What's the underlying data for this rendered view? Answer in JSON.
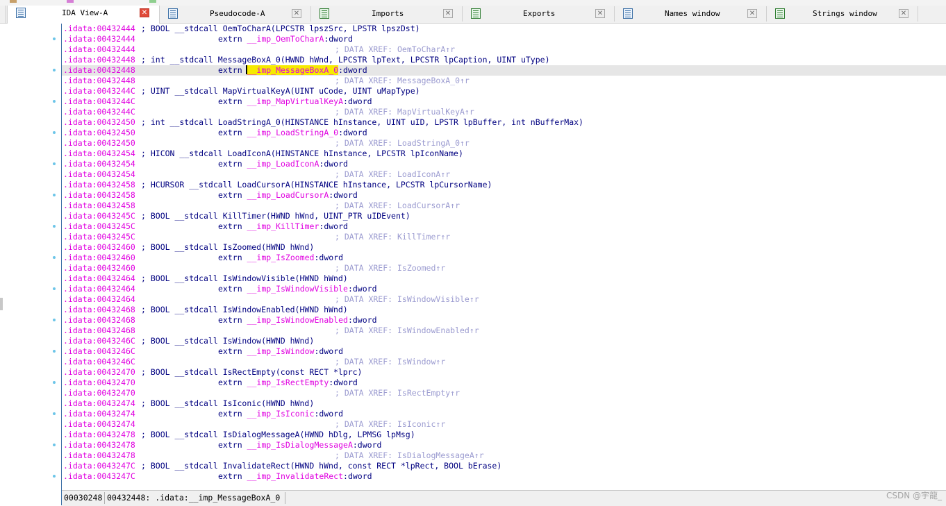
{
  "tabs": [
    {
      "label": "IDA View-A",
      "icon": "text-view-icon",
      "active": true
    },
    {
      "label": "Pseudocode-A",
      "icon": "text-view-icon",
      "active": false
    },
    {
      "label": "Imports",
      "icon": "imports-icon",
      "active": false
    },
    {
      "label": "Exports",
      "icon": "exports-icon",
      "active": false
    },
    {
      "label": "Names window",
      "icon": "names-list-icon",
      "active": false
    },
    {
      "label": "Strings window",
      "icon": "strings-icon",
      "active": false
    }
  ],
  "tab_close_glyph": "✕",
  "listing": [
    {
      "addr": ".idata:00432444",
      "text": "; BOOL __stdcall OemToCharA(LPCSTR lpszSrc, LPSTR lpszDst)",
      "kind": "comment"
    },
    {
      "addr": ".idata:00432444",
      "kw": "extrn ",
      "name": "__imp_OemToCharA",
      "tail": ":dword",
      "kind": "extrn"
    },
    {
      "addr": ".idata:00432444",
      "text": "; DATA XREF: OemToCharA↑r",
      "kind": "xref"
    },
    {
      "addr": ".idata:00432448",
      "text": "; int __stdcall MessageBoxA_0(HWND hWnd, LPCSTR lpText, LPCSTR lpCaption, UINT uType)",
      "kind": "comment"
    },
    {
      "addr": ".idata:00432448",
      "kw": "extrn ",
      "name": "__imp_MessageBoxA_0",
      "tail": ":dword",
      "kind": "extrn",
      "current": true
    },
    {
      "addr": ".idata:00432448",
      "text": "; DATA XREF: MessageBoxA_0↑r",
      "kind": "xref"
    },
    {
      "addr": ".idata:0043244C",
      "text": "; UINT __stdcall MapVirtualKeyA(UINT uCode, UINT uMapType)",
      "kind": "comment"
    },
    {
      "addr": ".idata:0043244C",
      "kw": "extrn ",
      "name": "__imp_MapVirtualKeyA",
      "tail": ":dword",
      "kind": "extrn"
    },
    {
      "addr": ".idata:0043244C",
      "text": "; DATA XREF: MapVirtualKeyA↑r",
      "kind": "xref"
    },
    {
      "addr": ".idata:00432450",
      "text": "; int __stdcall LoadStringA_0(HINSTANCE hInstance, UINT uID, LPSTR lpBuffer, int nBufferMax)",
      "kind": "comment"
    },
    {
      "addr": ".idata:00432450",
      "kw": "extrn ",
      "name": "__imp_LoadStringA_0",
      "tail": ":dword",
      "kind": "extrn"
    },
    {
      "addr": ".idata:00432450",
      "text": "; DATA XREF: LoadStringA_0↑r",
      "kind": "xref"
    },
    {
      "addr": ".idata:00432454",
      "text": "; HICON __stdcall LoadIconA(HINSTANCE hInstance, LPCSTR lpIconName)",
      "kind": "comment"
    },
    {
      "addr": ".idata:00432454",
      "kw": "extrn ",
      "name": "__imp_LoadIconA",
      "tail": ":dword",
      "kind": "extrn"
    },
    {
      "addr": ".idata:00432454",
      "text": "; DATA XREF: LoadIconA↑r",
      "kind": "xref"
    },
    {
      "addr": ".idata:00432458",
      "text": "; HCURSOR __stdcall LoadCursorA(HINSTANCE hInstance, LPCSTR lpCursorName)",
      "kind": "comment"
    },
    {
      "addr": ".idata:00432458",
      "kw": "extrn ",
      "name": "__imp_LoadCursorA",
      "tail": ":dword",
      "kind": "extrn"
    },
    {
      "addr": ".idata:00432458",
      "text": "; DATA XREF: LoadCursorA↑r",
      "kind": "xref"
    },
    {
      "addr": ".idata:0043245C",
      "text": "; BOOL __stdcall KillTimer(HWND hWnd, UINT_PTR uIDEvent)",
      "kind": "comment"
    },
    {
      "addr": ".idata:0043245C",
      "kw": "extrn ",
      "name": "__imp_KillTimer",
      "tail": ":dword",
      "kind": "extrn"
    },
    {
      "addr": ".idata:0043245C",
      "text": "; DATA XREF: KillTimer↑r",
      "kind": "xref"
    },
    {
      "addr": ".idata:00432460",
      "text": "; BOOL __stdcall IsZoomed(HWND hWnd)",
      "kind": "comment"
    },
    {
      "addr": ".idata:00432460",
      "kw": "extrn ",
      "name": "__imp_IsZoomed",
      "tail": ":dword",
      "kind": "extrn"
    },
    {
      "addr": ".idata:00432460",
      "text": "; DATA XREF: IsZoomed↑r",
      "kind": "xref"
    },
    {
      "addr": ".idata:00432464",
      "text": "; BOOL __stdcall IsWindowVisible(HWND hWnd)",
      "kind": "comment"
    },
    {
      "addr": ".idata:00432464",
      "kw": "extrn ",
      "name": "__imp_IsWindowVisible",
      "tail": ":dword",
      "kind": "extrn"
    },
    {
      "addr": ".idata:00432464",
      "text": "; DATA XREF: IsWindowVisible↑r",
      "kind": "xref"
    },
    {
      "addr": ".idata:00432468",
      "text": "; BOOL __stdcall IsWindowEnabled(HWND hWnd)",
      "kind": "comment"
    },
    {
      "addr": ".idata:00432468",
      "kw": "extrn ",
      "name": "__imp_IsWindowEnabled",
      "tail": ":dword",
      "kind": "extrn"
    },
    {
      "addr": ".idata:00432468",
      "text": "; DATA XREF: IsWindowEnabled↑r",
      "kind": "xref"
    },
    {
      "addr": ".idata:0043246C",
      "text": "; BOOL __stdcall IsWindow(HWND hWnd)",
      "kind": "comment"
    },
    {
      "addr": ".idata:0043246C",
      "kw": "extrn ",
      "name": "__imp_IsWindow",
      "tail": ":dword",
      "kind": "extrn"
    },
    {
      "addr": ".idata:0043246C",
      "text": "; DATA XREF: IsWindow↑r",
      "kind": "xref"
    },
    {
      "addr": ".idata:00432470",
      "text": "; BOOL __stdcall IsRectEmpty(const RECT *lprc)",
      "kind": "comment"
    },
    {
      "addr": ".idata:00432470",
      "kw": "extrn ",
      "name": "__imp_IsRectEmpty",
      "tail": ":dword",
      "kind": "extrn"
    },
    {
      "addr": ".idata:00432470",
      "text": "; DATA XREF: IsRectEmpty↑r",
      "kind": "xref"
    },
    {
      "addr": ".idata:00432474",
      "text": "; BOOL __stdcall IsIconic(HWND hWnd)",
      "kind": "comment"
    },
    {
      "addr": ".idata:00432474",
      "kw": "extrn ",
      "name": "__imp_IsIconic",
      "tail": ":dword",
      "kind": "extrn"
    },
    {
      "addr": ".idata:00432474",
      "text": "; DATA XREF: IsIconic↑r",
      "kind": "xref"
    },
    {
      "addr": ".idata:00432478",
      "text": "; BOOL __stdcall IsDialogMessageA(HWND hDlg, LPMSG lpMsg)",
      "kind": "comment"
    },
    {
      "addr": ".idata:00432478",
      "kw": "extrn ",
      "name": "__imp_IsDialogMessageA",
      "tail": ":dword",
      "kind": "extrn"
    },
    {
      "addr": ".idata:00432478",
      "text": "; DATA XREF: IsDialogMessageA↑r",
      "kind": "xref"
    },
    {
      "addr": ".idata:0043247C",
      "text": "; BOOL __stdcall InvalidateRect(HWND hWnd, const RECT *lpRect, BOOL bErase)",
      "kind": "comment"
    },
    {
      "addr": ".idata:0043247C",
      "kw": "extrn ",
      "name": "__imp_InvalidateRect",
      "tail": ":dword",
      "kind": "extrn"
    }
  ],
  "statusbar": {
    "file_offset": "00030248",
    "location": "00432448: .idata:__imp_MessageBoxA_0"
  },
  "watermark": "CSDN @宇龍_",
  "colors": {
    "address": "#e000e0",
    "code": "#000080",
    "xref": "#9b9bd0",
    "highlight": "#f6ea00",
    "current_line": "#e6e6e6",
    "tab_close_active": "#e04a3a",
    "xref_dot": "#6cc5e8"
  }
}
